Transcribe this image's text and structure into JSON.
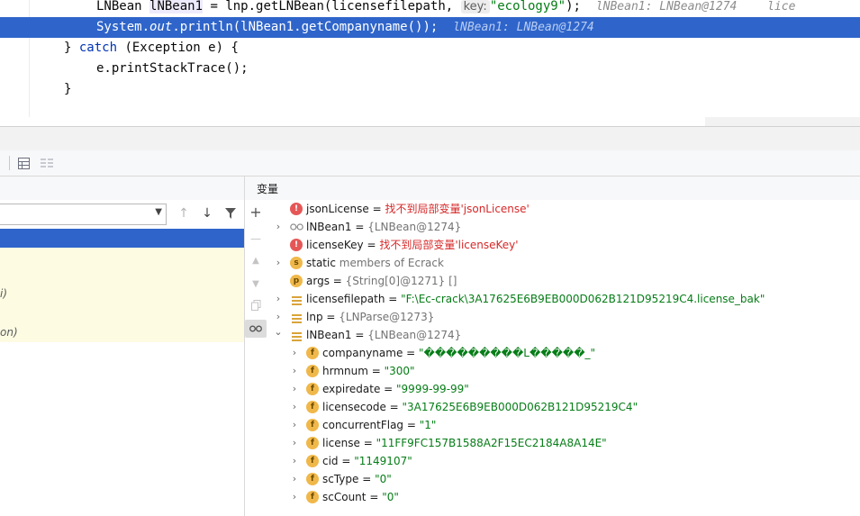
{
  "editor": {
    "line1": {
      "type_name": "LNBean",
      "var_name": "lNBean1",
      "assign": " = lnp.getLNBean(licensefilepath, ",
      "param_hint": "key:",
      "string_arg": "\"ecology9\"",
      "tail": ");",
      "inline_value": "lNBean1: LNBean@1274",
      "inline_value_2": "lice"
    },
    "line2": {
      "prefix": "System.",
      "out": "out",
      "call": ".println(lNBean1.getCompanyname());",
      "inline_value": "lNBean1: LNBean@1274"
    },
    "line3": {
      "close": "} ",
      "catch_kw": "catch",
      "rest": " (Exception e) {"
    },
    "line4": {
      "text": "e.printStackTrace();"
    },
    "line5": {
      "text": "}"
    }
  },
  "debug": {
    "variables_title": "变量",
    "frame_fragments": [
      "i)",
      "on)"
    ],
    "variables": [
      {
        "icon": "error-icon",
        "indent": 0,
        "expander": "",
        "name": "jsonLicense",
        "eq": " = ",
        "value": "找不到局部变量'jsonLicense'",
        "kind": "err"
      },
      {
        "icon": "watch-icon",
        "indent": 0,
        "expander": "›",
        "name": "lNBean1",
        "eq": " = ",
        "value": "{LNBean@1274}",
        "kind": "obj"
      },
      {
        "icon": "error-icon",
        "indent": 0,
        "expander": "",
        "name": "licenseKey",
        "eq": " = ",
        "value": "找不到局部变量'licenseKey'",
        "kind": "err"
      },
      {
        "icon": "static-icon",
        "indent": 0,
        "expander": "›",
        "name": "static",
        "eq": " ",
        "value": "members of Ecrack",
        "kind": "obj"
      },
      {
        "icon": "param-icon",
        "indent": 0,
        "expander": "",
        "name": "args",
        "eq": " = ",
        "value": "{String[0]@1271} []",
        "kind": "obj"
      },
      {
        "icon": "list-icon",
        "indent": 0,
        "expander": "›",
        "name": "licensefilepath",
        "eq": " = ",
        "value": "\"F:\\Ec-crack\\3A17625E6B9EB000D062B121D95219C4.license_bak\"",
        "kind": "str"
      },
      {
        "icon": "list-icon",
        "indent": 0,
        "expander": "›",
        "name": "lnp",
        "eq": " = ",
        "value": "{LNParse@1273}",
        "kind": "obj"
      },
      {
        "icon": "list-icon",
        "indent": 0,
        "expander": "⌄",
        "name": "lNBean1",
        "eq": " = ",
        "value": "{LNBean@1274}",
        "kind": "obj"
      },
      {
        "icon": "field-icon",
        "indent": 1,
        "expander": "›",
        "name": "companyname",
        "eq": " = ",
        "value": "\"���������L����\u0005�_\"",
        "kind": "str"
      },
      {
        "icon": "field-icon",
        "indent": 1,
        "expander": "›",
        "name": "hrmnum",
        "eq": " = ",
        "value": "\"300\"",
        "kind": "str"
      },
      {
        "icon": "field-icon",
        "indent": 1,
        "expander": "›",
        "name": "expiredate",
        "eq": " = ",
        "value": "\"9999-99-99\"",
        "kind": "str"
      },
      {
        "icon": "field-icon",
        "indent": 1,
        "expander": "›",
        "name": "licensecode",
        "eq": " = ",
        "value": "\"3A17625E6B9EB000D062B121D95219C4\"",
        "kind": "str"
      },
      {
        "icon": "field-icon",
        "indent": 1,
        "expander": "›",
        "name": "concurrentFlag",
        "eq": " = ",
        "value": "\"1\"",
        "kind": "str"
      },
      {
        "icon": "field-icon",
        "indent": 1,
        "expander": "›",
        "name": "license",
        "eq": " = ",
        "value": "\"11FF9FC157B1588A2F15EC2184A8A14E\"",
        "kind": "str"
      },
      {
        "icon": "field-icon",
        "indent": 1,
        "expander": "›",
        "name": "cid",
        "eq": " = ",
        "value": "\"1149107\"",
        "kind": "str"
      },
      {
        "icon": "field-icon",
        "indent": 1,
        "expander": "›",
        "name": "scType",
        "eq": " = ",
        "value": "\"0\"",
        "kind": "str"
      },
      {
        "icon": "field-icon",
        "indent": 1,
        "expander": "›",
        "name": "scCount",
        "eq": " = ",
        "value": "\"0\"",
        "kind": "str"
      }
    ]
  }
}
